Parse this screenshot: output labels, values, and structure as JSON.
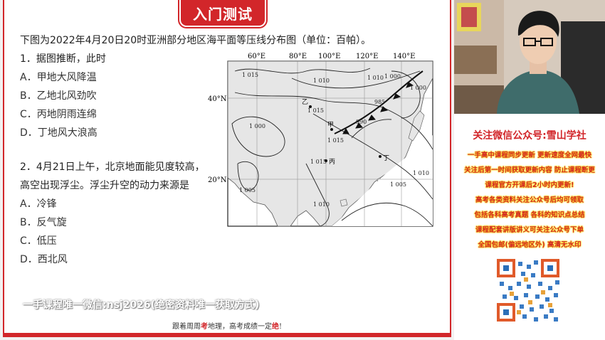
{
  "slide": {
    "title": "入门测试",
    "intro": "下图为2022年4月20日20时亚洲部分地区海平面等压线分布图（单位：百帕）。",
    "q1": {
      "stem": "1．据图推断，此时",
      "options": [
        "A．甲地大风降温",
        "B．乙地北风劲吹",
        "C．丙地阴雨连绵",
        "D．丁地风大浪高"
      ]
    },
    "q2": {
      "stem_line1": "2．4月21日上午，北京地面能见度较高，",
      "stem_line2": "高空出现浮尘。浮尘升空的动力来源是",
      "options": [
        "A．冷锋",
        "B．反气旋",
        "C．低压",
        "D．西北风"
      ]
    },
    "map": {
      "lon_labels": [
        "60°E",
        "80°E",
        "100°E",
        "120°E",
        "140°E"
      ],
      "lat_labels": [
        "40°N",
        "20°N"
      ],
      "isobars": [
        "1 015",
        "1 010",
        "1 010",
        "1 015",
        "1 000",
        "1 005",
        "1 015",
        "1 010",
        "1 000",
        "1 000",
        "1 005",
        "985",
        "990",
        "1 010",
        "1 015"
      ],
      "places": [
        "甲",
        "乙",
        "丙",
        "丁"
      ],
      "colors": {
        "land": "#e6e6e6",
        "line": "#222222",
        "front": "#111111"
      }
    },
    "watermark": "一手课程唯一微信:nsj2026(绝密资料唯一获取方式)",
    "footer": {
      "part1": "跟着周周",
      "highlight1": "考",
      "part2": "地理，高考成绩一定",
      "highlight2": "绝",
      "part3": "!"
    },
    "accent_color": "#d2262a"
  },
  "promo": {
    "title": "关注微信公众号:雪山学社",
    "lines": [
      "一手高中课程同步更新 更新速度全网最快",
      "关注后第一时间获取更新内容 防止课程断更",
      "课程官方开课后2小时内更新!",
      "高考各类资料关注公众号后均可领取",
      "包括各科高考真题 各科的知识点总结",
      "课程配套讲版讲义可关注公众号下单",
      "全国包邮(偏远地区外) 高清无水印"
    ],
    "qr_icon": "qr-code-icon"
  }
}
